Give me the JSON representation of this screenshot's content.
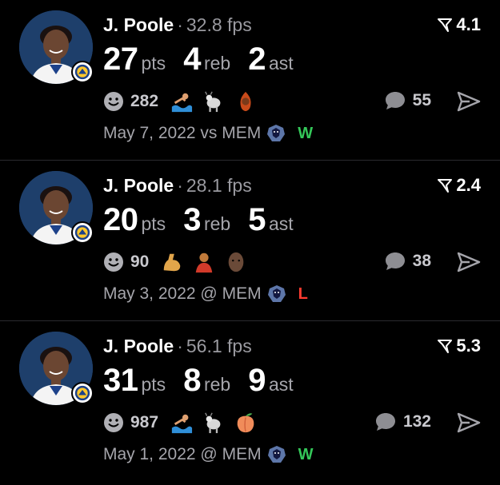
{
  "colors": {
    "background": "#000000",
    "win": "#34c759",
    "loss": "#ff3b30",
    "muted": "#9a9aa0",
    "divider": "#2a2a2e"
  },
  "posts": [
    {
      "player": "J. Poole",
      "dot": "·",
      "fps": "32.8 fps",
      "score": "4.1",
      "pts": "27",
      "pts_label": "pts",
      "reb": "4",
      "reb_label": "reb",
      "ast": "2",
      "ast_label": "ast",
      "reaction_count": "282",
      "reaction_emojis": [
        "swimmer-emoji",
        "goat-emoji",
        "fire-person-emoji"
      ],
      "comment_count": "55",
      "date": "May 7, 2022",
      "venue": "vs MEM",
      "result": "W"
    },
    {
      "player": "J. Poole",
      "dot": "·",
      "fps": "28.1 fps",
      "score": "2.4",
      "pts": "20",
      "pts_label": "pts",
      "reb": "3",
      "reb_label": "reb",
      "ast": "5",
      "ast_label": "ast",
      "reaction_count": "90",
      "reaction_emojis": [
        "flexed-biceps-emoji",
        "person-emoji",
        "face-emoji"
      ],
      "comment_count": "38",
      "date": "May 3, 2022",
      "venue": "@ MEM",
      "result": "L"
    },
    {
      "player": "J. Poole",
      "dot": "·",
      "fps": "56.1 fps",
      "score": "5.3",
      "pts": "31",
      "pts_label": "pts",
      "reb": "8",
      "reb_label": "reb",
      "ast": "9",
      "ast_label": "ast",
      "reaction_count": "987",
      "reaction_emojis": [
        "swimmer-emoji",
        "goat-emoji",
        "peach-emoji"
      ],
      "comment_count": "132",
      "date": "May 1, 2022",
      "venue": "@ MEM",
      "result": "W"
    }
  ]
}
